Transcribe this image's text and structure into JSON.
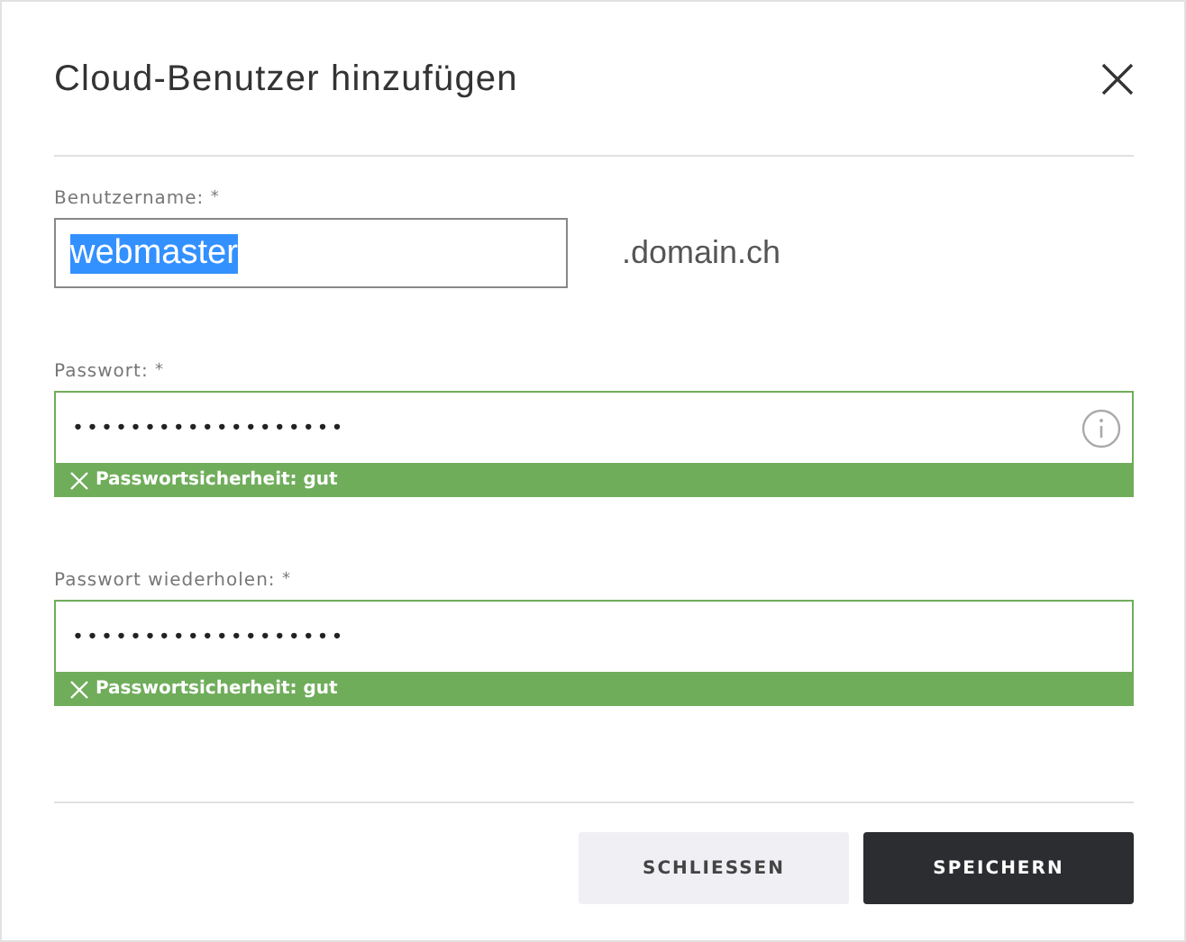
{
  "dialog": {
    "title": "Cloud-Benutzer hinzufügen"
  },
  "username": {
    "label": "Benutzername:",
    "required_mark": "*",
    "value": "webmaster",
    "value_selected": true,
    "suffix": ".domain.ch"
  },
  "password_fields": [
    {
      "label": "Passwort:",
      "required_mark": "*",
      "value": "•••••••••••••••••••",
      "info_icon": true,
      "strength": "Passwortsicherheit: gut",
      "valid": true
    },
    {
      "label": "Passwort wiederholen:",
      "required_mark": "*",
      "value": "•••••••••••••••••••",
      "info_icon": false,
      "strength": "Passwortsicherheit: gut",
      "valid": true
    }
  ],
  "buttons": [
    {
      "label": "SCHLIESSEN",
      "kind": "secondary"
    },
    {
      "label": "SPEICHERN",
      "kind": "primary"
    }
  ]
}
